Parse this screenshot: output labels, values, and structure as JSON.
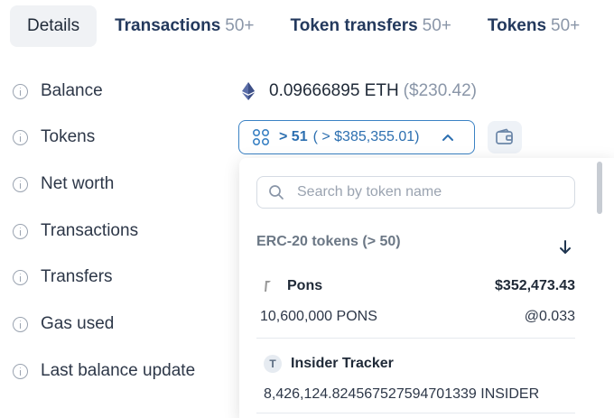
{
  "tabs": [
    {
      "label": "Details",
      "count": ""
    },
    {
      "label": "Transactions",
      "count": "50+"
    },
    {
      "label": "Token transfers",
      "count": "50+"
    },
    {
      "label": "Tokens",
      "count": "50+"
    }
  ],
  "details": {
    "labels": [
      "Balance",
      "Tokens",
      "Net worth",
      "Transactions",
      "Transfers",
      "Gas used",
      "Last balance update"
    ]
  },
  "balance": {
    "amount": "0.09666895 ETH",
    "usd": "($230.42)"
  },
  "tokens_button": {
    "count": "> 51",
    "total": "( > $385,355.01)"
  },
  "dropdown": {
    "search_placeholder": "Search by token name",
    "section_title": "ERC-20 tokens (> 50)",
    "items": [
      {
        "name": "Pons",
        "value": "$352,473.43",
        "quantity": "10,600,000 PONS",
        "price": "@0.033",
        "icon": "pons-token-icon"
      },
      {
        "name": "Insider Tracker",
        "value": "",
        "quantity": "8,426,124.824567527594701339 INSIDER",
        "price": "",
        "icon": "T"
      }
    ]
  },
  "colors": {
    "accent": "#3b82c4",
    "muted": "#8a96a8",
    "tab_text": "#23395d"
  }
}
